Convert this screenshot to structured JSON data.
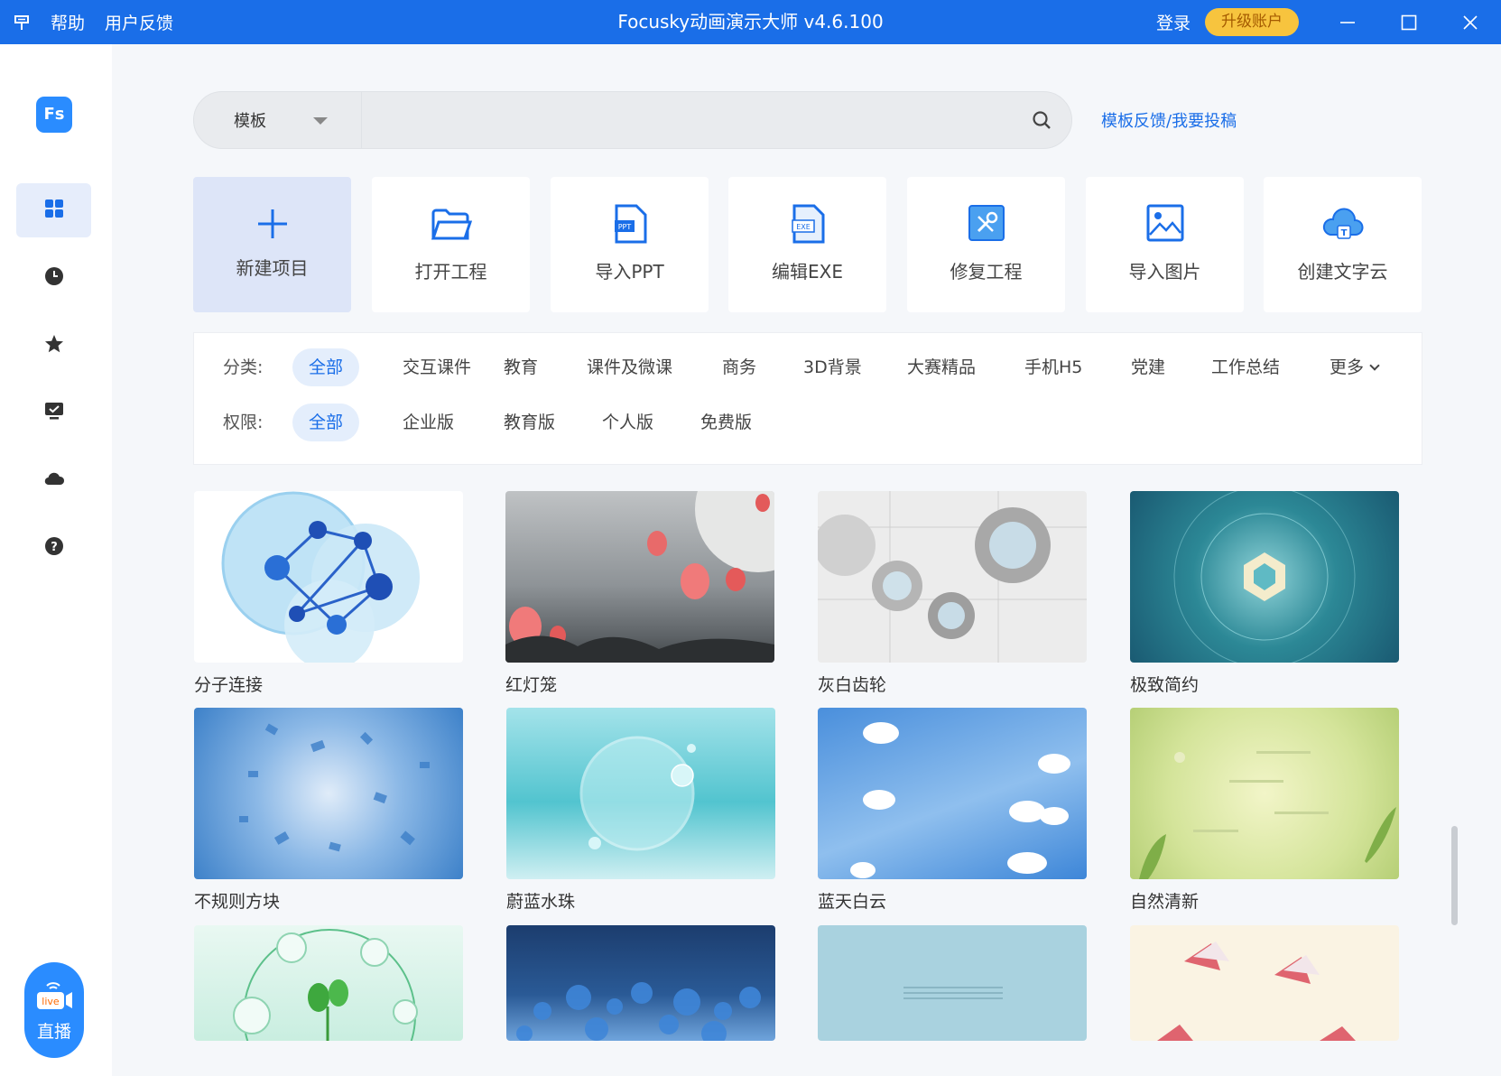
{
  "titlebar": {
    "menu": [
      "帮助",
      "用户反馈"
    ],
    "title": "Focusky动画演示大师 v4.6.100",
    "login": "登录",
    "upgrade": "升级账户"
  },
  "sidebar": {
    "logo": "Fs",
    "items": [
      "apps-icon",
      "history-icon",
      "star-icon",
      "screen-check-icon",
      "cloud-icon",
      "help-icon"
    ],
    "live_badge": "live",
    "live_label": "直播"
  },
  "search": {
    "scope": "模板",
    "placeholder": "",
    "feedback_link": "模板反馈/我要投稿"
  },
  "actions": [
    {
      "label": "新建项目",
      "icon": "plus-icon"
    },
    {
      "label": "打开工程",
      "icon": "folder-icon"
    },
    {
      "label": "导入PPT",
      "icon": "ppt-file-icon"
    },
    {
      "label": "编辑EXE",
      "icon": "exe-file-icon"
    },
    {
      "label": "修复工程",
      "icon": "repair-icon"
    },
    {
      "label": "导入图片",
      "icon": "image-icon"
    },
    {
      "label": "创建文字云",
      "icon": "cloud-text-icon"
    }
  ],
  "filters": {
    "category_label": "分类:",
    "categories": [
      "全部",
      "交互课件",
      "教育",
      "课件及微课",
      "商务",
      "3D背景",
      "大赛精品",
      "手机H5",
      "党建",
      "工作总结"
    ],
    "more": "更多",
    "permission_label": "权限:",
    "permissions": [
      "全部",
      "企业版",
      "教育版",
      "个人版",
      "免费版"
    ]
  },
  "templates": [
    {
      "title": "分子连接"
    },
    {
      "title": "红灯笼"
    },
    {
      "title": "灰白齿轮"
    },
    {
      "title": "极致简约"
    },
    {
      "title": "不规则方块"
    },
    {
      "title": "蔚蓝水珠"
    },
    {
      "title": "蓝天白云"
    },
    {
      "title": "自然清新"
    },
    {
      "title": ""
    },
    {
      "title": ""
    },
    {
      "title": ""
    },
    {
      "title": ""
    }
  ],
  "colors": {
    "brand": "#1a6ee8",
    "upgrade": "#f7c43e",
    "live": "#2a8cff"
  }
}
